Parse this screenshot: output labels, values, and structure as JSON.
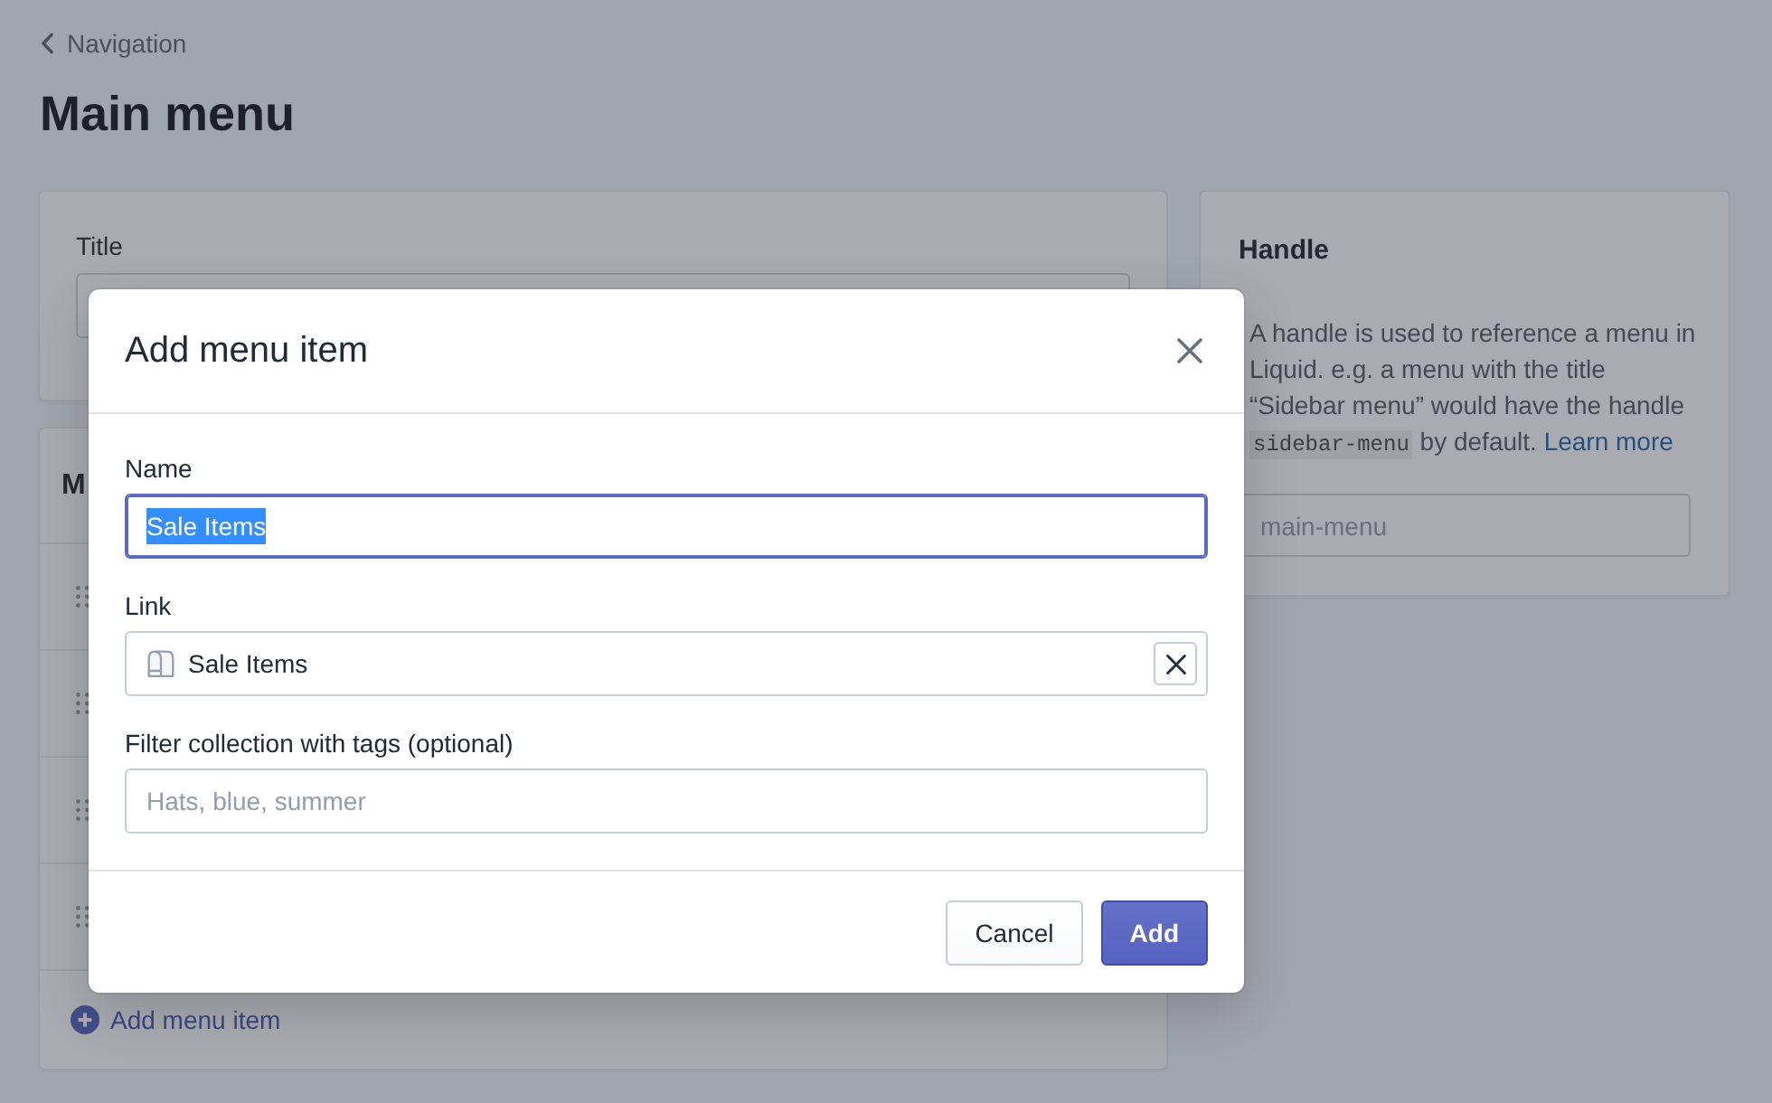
{
  "breadcrumb": {
    "label": "Navigation"
  },
  "page_title": "Main menu",
  "title_card": {
    "label": "Title"
  },
  "menu_card": {
    "heading": "M",
    "items": [
      {
        "draggable": true
      },
      {
        "draggable": true
      },
      {
        "draggable": true
      },
      {
        "draggable": true
      }
    ],
    "add_action": "Add menu item"
  },
  "handle_card": {
    "heading": "Handle",
    "description": [
      {
        "kind": "text",
        "text": "A handle is used to reference a menu in Liquid. e.g. a menu with the title “Sidebar menu” would have the handle "
      },
      {
        "kind": "code",
        "text": "sidebar-menu"
      },
      {
        "kind": "text",
        "text": " by default. "
      },
      {
        "kind": "link",
        "text": "Learn more"
      }
    ],
    "field": {
      "placeholder": "main-menu"
    }
  },
  "dialog": {
    "title": "Add menu item",
    "fields": [
      {
        "kind": "text",
        "label": "Name",
        "value": "Sale Items",
        "focused": true,
        "value_selected": true
      },
      {
        "kind": "resource",
        "label": "Link",
        "value": "Sale Items",
        "clearable": true
      },
      {
        "kind": "text",
        "label": "Filter collection with tags (optional)",
        "placeholder": "Hats, blue, summer",
        "focused": false
      }
    ],
    "buttons": [
      {
        "kind": "secondary",
        "label": "Cancel"
      },
      {
        "kind": "primary",
        "label": "Add"
      }
    ]
  }
}
